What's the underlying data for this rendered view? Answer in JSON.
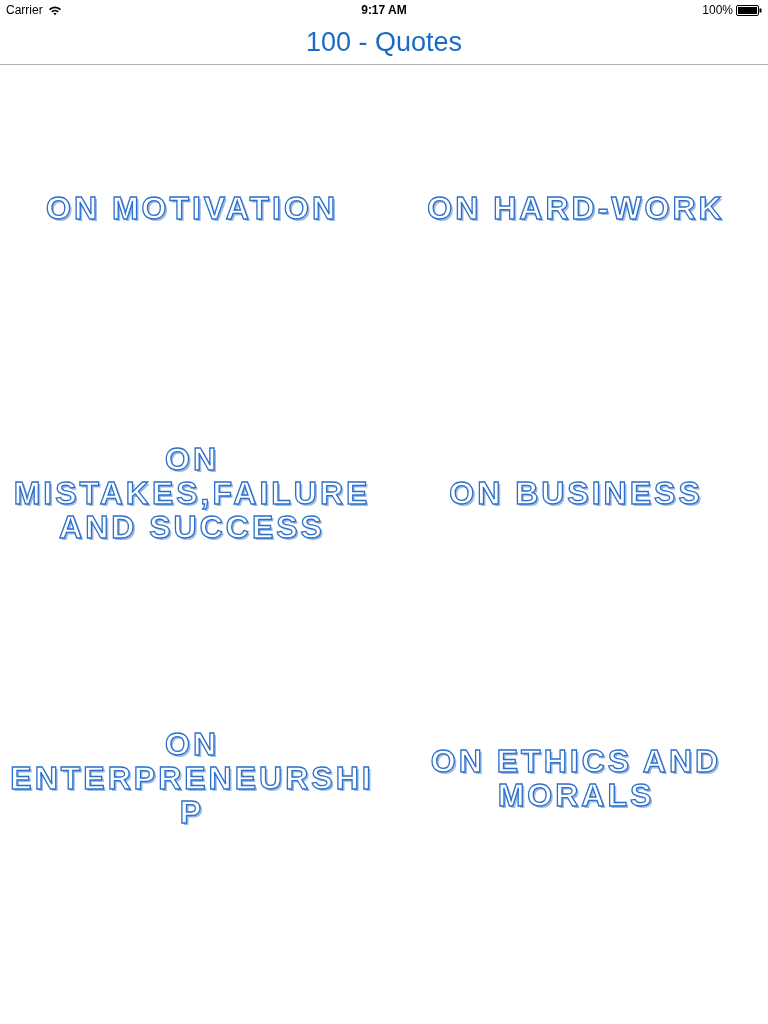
{
  "status_bar": {
    "carrier": "Carrier",
    "time": "9:17 AM",
    "battery": "100%"
  },
  "nav_bar": {
    "title": "100 - Quotes"
  },
  "categories": [
    {
      "label": "ON MOTIVATION"
    },
    {
      "label": "ON HARD-WORK"
    },
    {
      "label": "ON MISTAKES,FAILURE AND SUCCESS"
    },
    {
      "label": "ON BUSINESS"
    },
    {
      "label": "ON ENTERPRENEURSHIP"
    },
    {
      "label": "ON ETHICS AND MORALS"
    }
  ]
}
